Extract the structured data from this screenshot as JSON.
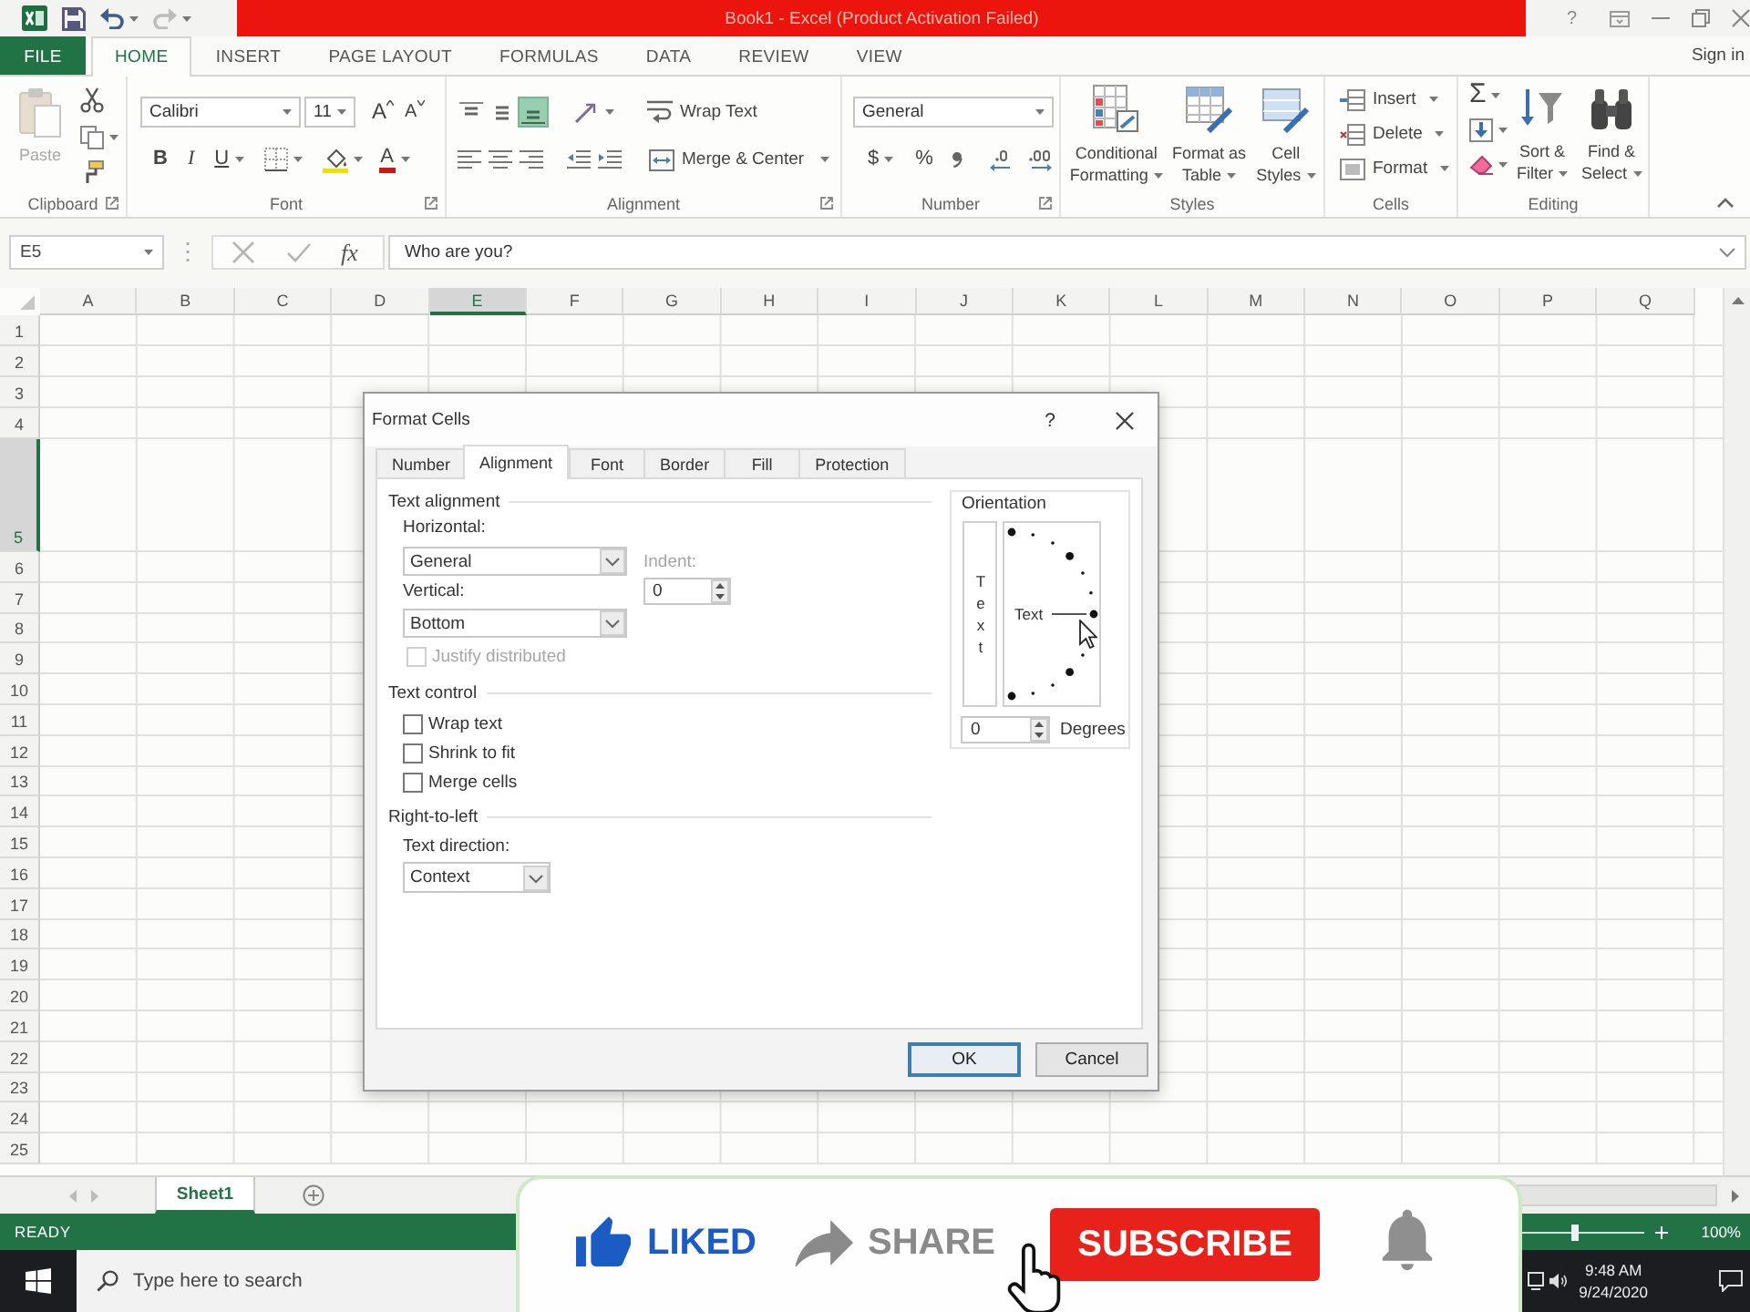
{
  "title_bar": {
    "title": "Book1 - Excel (Product Activation Failed)",
    "help": "?"
  },
  "ribbon_tabs": [
    {
      "label": "FILE",
      "kind": "file",
      "selected": false
    },
    {
      "label": "HOME",
      "kind": "tab",
      "selected": true
    },
    {
      "label": "INSERT",
      "kind": "tab",
      "selected": false
    },
    {
      "label": "PAGE LAYOUT",
      "kind": "tab",
      "selected": false
    },
    {
      "label": "FORMULAS",
      "kind": "tab",
      "selected": false
    },
    {
      "label": "DATA",
      "kind": "tab",
      "selected": false
    },
    {
      "label": "REVIEW",
      "kind": "tab",
      "selected": false
    },
    {
      "label": "VIEW",
      "kind": "tab",
      "selected": false
    }
  ],
  "account": {
    "sign_in": "Sign in"
  },
  "ribbon": {
    "clipboard": {
      "label": "Clipboard",
      "paste": {
        "label": "Paste",
        "disabled": true
      }
    },
    "font": {
      "label": "Font",
      "font_name": "Calibri",
      "font_size": "11",
      "grow_font": "A",
      "shrink_font": "A",
      "bold": "B",
      "italic": "I",
      "underline": "U",
      "font_color": "A"
    },
    "alignment": {
      "label": "Alignment",
      "align_top": {
        "selected": false
      },
      "align_middle": {
        "selected": false
      },
      "align_bottom": {
        "selected": true
      },
      "wrap_text": "Wrap Text",
      "merge": "Merge & Center"
    },
    "number": {
      "label": "Number",
      "format": "General",
      "currency": "$",
      "percent": "%"
    },
    "styles": {
      "label": "Styles",
      "conditional_formatting": "Conditional Formatting",
      "format_as_table": "Format as Table",
      "cell_styles": "Cell Styles"
    },
    "cells": {
      "label": "Cells",
      "insert": "Insert",
      "delete": "Delete",
      "format": "Format"
    },
    "editing": {
      "label": "Editing",
      "autosum": "Σ",
      "sort_filter": "Sort & Filter",
      "find_select": "Find & Select"
    }
  },
  "formula_bar": {
    "name_box": "E5",
    "insert_function": "fx",
    "formula": "Who are you?"
  },
  "sheet": {
    "columns": [
      {
        "label": "A",
        "selected": false
      },
      {
        "label": "B",
        "selected": false
      },
      {
        "label": "C",
        "selected": false
      },
      {
        "label": "D",
        "selected": false
      },
      {
        "label": "E",
        "selected": true
      },
      {
        "label": "F",
        "selected": false
      },
      {
        "label": "G",
        "selected": false
      },
      {
        "label": "H",
        "selected": false
      },
      {
        "label": "I",
        "selected": false
      },
      {
        "label": "J",
        "selected": false
      },
      {
        "label": "K",
        "selected": false
      },
      {
        "label": "L",
        "selected": false
      },
      {
        "label": "M",
        "selected": false
      },
      {
        "label": "N",
        "selected": false
      },
      {
        "label": "O",
        "selected": false
      },
      {
        "label": "P",
        "selected": false
      },
      {
        "label": "Q",
        "selected": false
      }
    ],
    "rows": [
      {
        "label": "1",
        "selected": false
      },
      {
        "label": "2",
        "selected": false
      },
      {
        "label": "3",
        "selected": false
      },
      {
        "label": "4",
        "selected": false
      },
      {
        "label": "5",
        "selected": true
      },
      {
        "label": "6",
        "selected": false
      },
      {
        "label": "7",
        "selected": false
      },
      {
        "label": "8",
        "selected": false
      },
      {
        "label": "9",
        "selected": false
      },
      {
        "label": "10",
        "selected": false
      },
      {
        "label": "11",
        "selected": false
      },
      {
        "label": "12",
        "selected": false
      },
      {
        "label": "13",
        "selected": false
      },
      {
        "label": "14",
        "selected": false
      },
      {
        "label": "15",
        "selected": false
      },
      {
        "label": "16",
        "selected": false
      },
      {
        "label": "17",
        "selected": false
      },
      {
        "label": "18",
        "selected": false
      },
      {
        "label": "19",
        "selected": false
      },
      {
        "label": "20",
        "selected": false
      },
      {
        "label": "21",
        "selected": false
      },
      {
        "label": "22",
        "selected": false
      },
      {
        "label": "23",
        "selected": false
      },
      {
        "label": "24",
        "selected": false
      },
      {
        "label": "25",
        "selected": false
      }
    ]
  },
  "dialog": {
    "title": "Format Cells",
    "help": "?",
    "tabs": [
      {
        "label": "Number",
        "selected": false
      },
      {
        "label": "Alignment",
        "selected": true
      },
      {
        "label": "Font",
        "selected": false
      },
      {
        "label": "Border",
        "selected": false
      },
      {
        "label": "Fill",
        "selected": false
      },
      {
        "label": "Protection",
        "selected": false
      }
    ],
    "text_alignment": {
      "heading": "Text alignment",
      "horizontal": {
        "label": "Horizontal:",
        "value": "General"
      },
      "indent": {
        "label": "Indent:",
        "value": "0",
        "disabled": true
      },
      "vertical": {
        "label": "Vertical:",
        "value": "Bottom"
      },
      "justify_distributed": {
        "label": "Justify distributed",
        "checked": false,
        "disabled": true
      }
    },
    "text_control": {
      "heading": "Text control",
      "options": [
        {
          "label": "Wrap text",
          "checked": false
        },
        {
          "label": "Shrink to fit",
          "checked": false
        },
        {
          "label": "Merge cells",
          "checked": false
        }
      ]
    },
    "right_to_left": {
      "heading": "Right-to-left",
      "text_direction": {
        "label": "Text direction:",
        "value": "Context"
      }
    },
    "orientation": {
      "heading": "Orientation",
      "vertical_text": "Text",
      "dial_text": "Text",
      "degrees": {
        "value": "0",
        "label": "Degrees"
      }
    },
    "buttons": [
      {
        "label": "OK",
        "default": true
      },
      {
        "label": "Cancel",
        "default": false
      }
    ]
  },
  "sheet_tabs": [
    {
      "label": "Sheet1",
      "selected": true
    }
  ],
  "status_bar": {
    "status": "READY",
    "zoom": {
      "level": 0.5,
      "reading": "100%"
    }
  },
  "taskbar": {
    "search": {
      "placeholder": "Type here to search"
    },
    "time": "9:48 AM",
    "date": "9/24/2020"
  },
  "video_overlay": {
    "like": {
      "label": "LIKED",
      "on": true
    },
    "share": {
      "label": "SHARE"
    },
    "subscribe": {
      "label": "SUBSCRIBE"
    }
  }
}
